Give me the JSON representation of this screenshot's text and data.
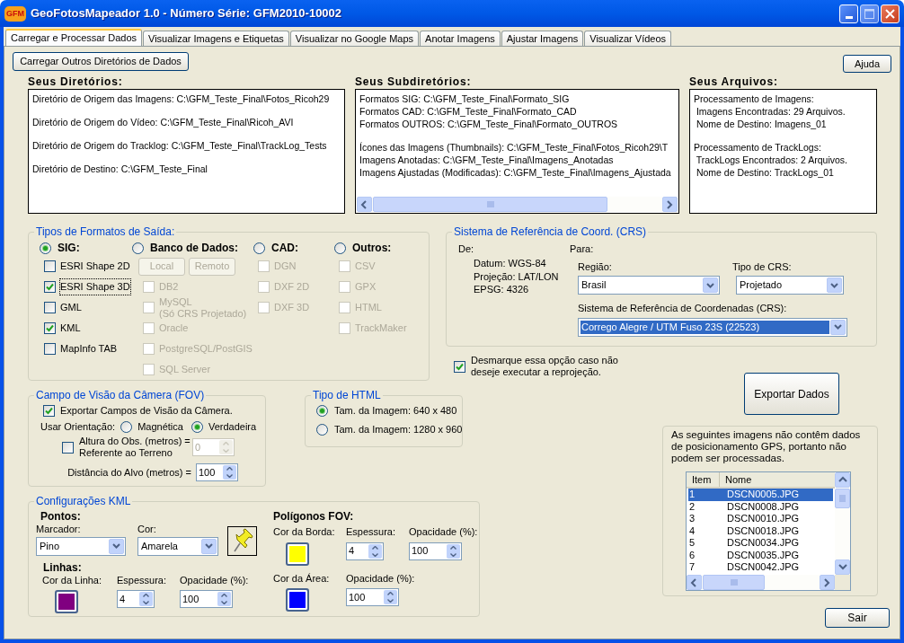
{
  "window": {
    "icon_text": "GFM",
    "title": "GeoFotosMapeador 1.0 - Número Série: GFM2010-10002"
  },
  "tabs": [
    {
      "label": "Carregar e Processar Dados",
      "selected": true
    },
    {
      "label": "Visualizar Imagens e Etiquetas",
      "selected": false
    },
    {
      "label": "Visualizar no Google Maps",
      "selected": false
    },
    {
      "label": "Anotar Imagens",
      "selected": false
    },
    {
      "label": "Ajustar Imagens",
      "selected": false
    },
    {
      "label": "Visualizar Vídeos",
      "selected": false
    }
  ],
  "top_buttons": {
    "load": "Carregar Outros Diretórios de Dados",
    "help": "Ajuda"
  },
  "info_panels": [
    {
      "title": "Seus Diretórios:",
      "kind": "plain",
      "paragraphs": [
        [
          "Diretório de Origem das Imagens: C:\\GFM_Teste_Final\\Fotos_Ricoh29"
        ],
        [
          "Diretório de Origem do Vídeo: C:\\GFM_Teste_Final\\Ricoh_AVI"
        ],
        [
          "Diretório de Origem do Tracklog: C:\\GFM_Teste_Final\\TrackLog_Tests"
        ],
        [
          "Diretório de Destino: C:\\GFM_Teste_Final"
        ]
      ]
    },
    {
      "title": "Seus Subdiretórios:",
      "kind": "scrolling",
      "paragraphs": [
        [
          "Formatos SIG: C:\\GFM_Teste_Final\\Formato_SIG",
          "Formatos CAD: C:\\GFM_Teste_Final\\Formato_CAD",
          "Formatos OUTROS: C:\\GFM_Teste_Final\\Formato_OUTROS"
        ],
        [
          "Ícones das Imagens (Thumbnails): C:\\GFM_Teste_Final\\Fotos_Ricoh29\\T",
          "Imagens Anotadas: C:\\GFM_Teste_Final\\Imagens_Anotadas",
          "Imagens Ajustadas (Modificadas): C:\\GFM_Teste_Final\\Imagens_Ajustada"
        ]
      ]
    },
    {
      "title": "Seus Arquivos:",
      "kind": "plain",
      "paragraphs": [
        [
          "Processamento de Imagens:",
          " Imagens Encontradas: 29 Arquivos.",
          " Nome de Destino: Imagens_01"
        ],
        [
          "Processamento de TrackLogs:",
          " TrackLogs Encontrados: 2 Arquivos.",
          " Nome de Destino: TrackLogs_01"
        ]
      ]
    }
  ],
  "output_formats": {
    "title": "Tipos de Formatos de Saída:",
    "groups": [
      {
        "label": "SIG:",
        "selected": true,
        "options": [
          {
            "label": "ESRI Shape 2D",
            "checked": false,
            "disabled": false,
            "focused": false
          },
          {
            "label": "ESRI Shape 3D",
            "checked": true,
            "disabled": false,
            "focused": true
          },
          {
            "label": "GML",
            "checked": false,
            "disabled": false,
            "focused": false
          },
          {
            "label": "KML",
            "checked": true,
            "disabled": false,
            "focused": false
          },
          {
            "label": "MapInfo TAB",
            "checked": false,
            "disabled": false,
            "focused": false
          }
        ]
      },
      {
        "label": "Banco de Dados:",
        "selected": false,
        "buttons": [
          {
            "label": "Local",
            "disabled": true
          },
          {
            "label": "Remoto",
            "disabled": true
          }
        ],
        "options": [
          {
            "label": "DB2",
            "checked": false,
            "disabled": true,
            "focused": false
          },
          {
            "label": "MySQL",
            "note": "(Só CRS Projetado)",
            "checked": false,
            "disabled": true,
            "focused": false
          },
          {
            "label": "Oracle",
            "checked": false,
            "disabled": true,
            "focused": false
          },
          {
            "label": "PostgreSQL/PostGIS",
            "checked": false,
            "disabled": true,
            "focused": false
          },
          {
            "label": "SQL Server",
            "checked": false,
            "disabled": true,
            "focused": false
          }
        ]
      },
      {
        "label": "CAD:",
        "selected": false,
        "options": [
          {
            "label": "DGN",
            "checked": false,
            "disabled": true,
            "focused": false
          },
          {
            "label": "DXF 2D",
            "checked": false,
            "disabled": true,
            "focused": false
          },
          {
            "label": "DXF 3D",
            "checked": false,
            "disabled": true,
            "focused": false
          }
        ]
      },
      {
        "label": "Outros:",
        "selected": false,
        "options": [
          {
            "label": "CSV",
            "checked": false,
            "disabled": true,
            "focused": false
          },
          {
            "label": "GPX",
            "checked": false,
            "disabled": true,
            "focused": false
          },
          {
            "label": "HTML",
            "checked": false,
            "disabled": true,
            "focused": false
          },
          {
            "label": "TrackMaker",
            "checked": false,
            "disabled": true,
            "focused": false
          }
        ]
      }
    ]
  },
  "crs": {
    "title": "Sistema de Referência de Coord. (CRS)",
    "from_label": "De:",
    "from_lines": [
      "Datum: WGS-84",
      "Projeção: LAT/LON",
      "EPSG: 4326"
    ],
    "to_label": "Para:",
    "region": {
      "label": "Região:",
      "value": "Brasil"
    },
    "crs_type": {
      "label": "Tipo de CRS:",
      "value": "Projetado"
    },
    "crs_system": {
      "label": "Sistema de Referência de Coordenadas (CRS):",
      "value": "Corrego Alegre / UTM Fuso 23S (22523)",
      "focused": true
    }
  },
  "reproject": {
    "lines": [
      "Desmarque essa opção caso não",
      "deseje executar a reprojeção."
    ],
    "checked": true
  },
  "export_button": "Exportar Dados",
  "fov": {
    "title": "Campo de Visão da Câmera (FOV)",
    "export": {
      "label": "Exportar Campos de Visão da Câmera.",
      "checked": true
    },
    "orientation": {
      "label": "Usar Orientação:",
      "options": [
        {
          "label": "Magnética",
          "selected": false
        },
        {
          "label": "Verdadeira",
          "selected": true
        }
      ]
    },
    "height": {
      "lines": [
        "Altura do Obs. (metros) =",
        "Referente ao Terreno"
      ],
      "checked": false,
      "value": "0",
      "disabled": true
    },
    "distance": {
      "label": "Distância do Alvo (metros) =",
      "value": "100"
    }
  },
  "html_type": {
    "title": "Tipo de HTML",
    "options": [
      {
        "label": "Tam. da Imagem: 640 x 480",
        "selected": true
      },
      {
        "label": "Tam. da Imagem: 1280 x 960",
        "selected": false
      }
    ]
  },
  "kml": {
    "title": "Configurações KML",
    "points": {
      "heading": "Pontos:",
      "marker": {
        "label": "Marcador:",
        "value": "Pino"
      },
      "color": {
        "label": "Cor:",
        "value": "Amarela"
      }
    },
    "lines": {
      "heading": "Linhas:",
      "color": {
        "label": "Cor da Linha:",
        "color": "#800080"
      },
      "thickness": {
        "label": "Espessura:",
        "value": "4"
      },
      "opacity": {
        "label": "Opacidade (%):",
        "value": "100"
      }
    },
    "polygons": {
      "heading": "Polígonos FOV:",
      "border_color": {
        "label": "Cor da Borda:",
        "color": "#ffff00"
      },
      "thickness": {
        "label": "Espessura:",
        "value": "4"
      },
      "opacity": {
        "label": "Opacidade (%):",
        "value": "100"
      },
      "area_color": {
        "label": "Cor da Área:",
        "color": "#0000ff"
      },
      "area_opacity": {
        "label": "Opacidade (%):",
        "value": "100"
      }
    }
  },
  "no_gps": {
    "message": "As seguintes imagens não contêm dados de posicionamento GPS, portanto não podem ser processadas.",
    "columns": [
      "Item",
      "Nome"
    ],
    "rows": [
      {
        "item": "1",
        "name": "DSCN0005.JPG",
        "selected": true
      },
      {
        "item": "2",
        "name": "DSCN0008.JPG",
        "selected": false
      },
      {
        "item": "3",
        "name": "DSCN0010.JPG",
        "selected": false
      },
      {
        "item": "4",
        "name": "DSCN0018.JPG",
        "selected": false
      },
      {
        "item": "5",
        "name": "DSCN0034.JPG",
        "selected": false
      },
      {
        "item": "6",
        "name": "DSCN0035.JPG",
        "selected": false
      },
      {
        "item": "7",
        "name": "DSCN0042.JPG",
        "selected": false
      }
    ]
  },
  "exit_button": "Sair"
}
